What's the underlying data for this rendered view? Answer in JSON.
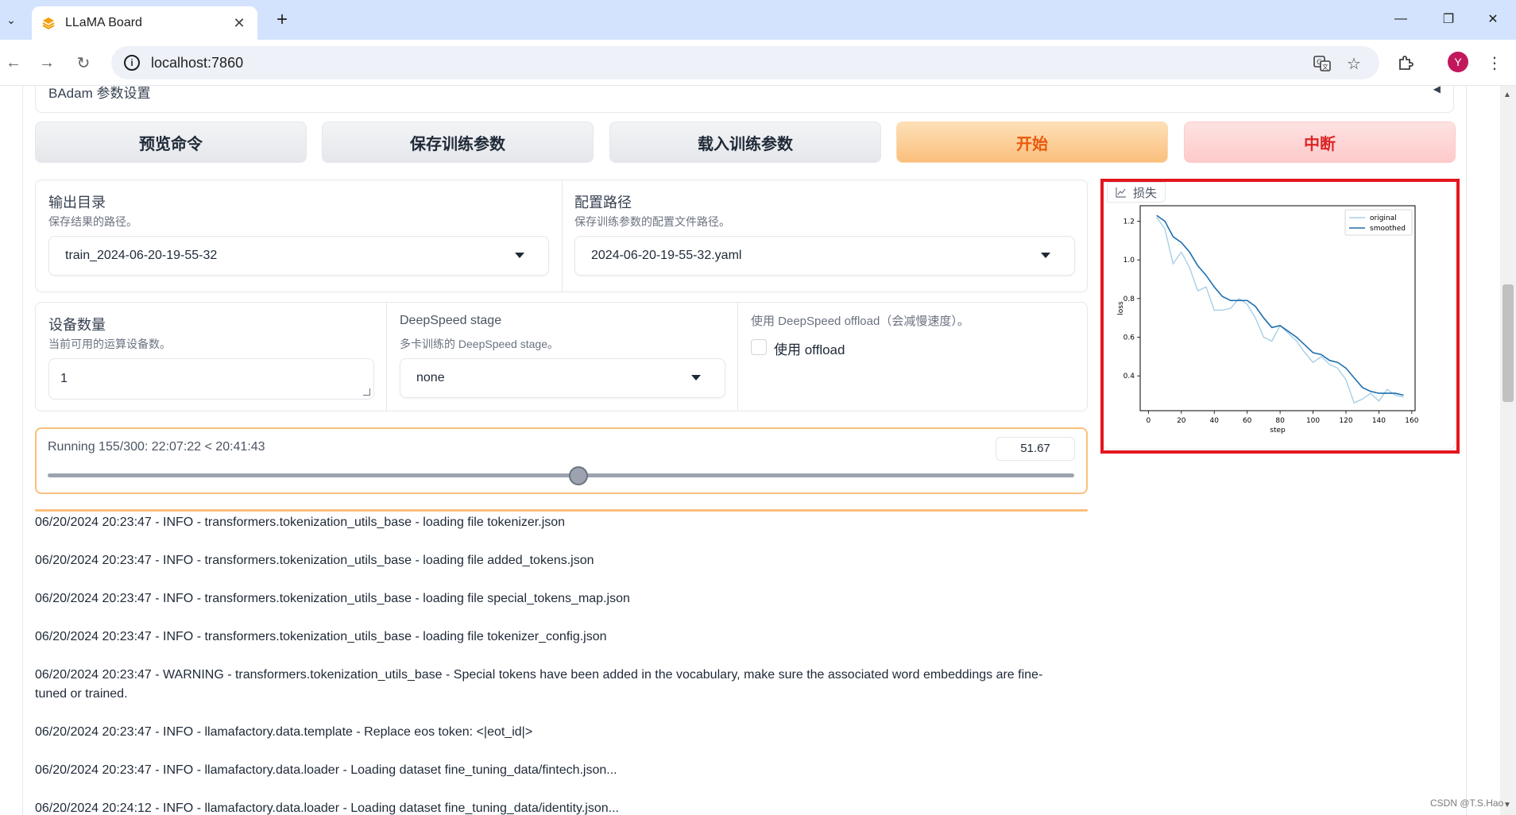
{
  "browser": {
    "tab_title": "LLaMA Board",
    "url": "localhost:7860",
    "avatar_letter": "Y"
  },
  "accordion": {
    "label": "BAdam 参数设置"
  },
  "buttons": {
    "preview": "预览命令",
    "save": "保存训练参数",
    "load": "载入训练参数",
    "start": "开始",
    "abort": "中断"
  },
  "output_dir": {
    "label": "输出目录",
    "info": "保存结果的路径。",
    "value": "train_2024-06-20-19-55-32"
  },
  "config_path": {
    "label": "配置路径",
    "info": "保存训练参数的配置文件路径。",
    "value": "2024-06-20-19-55-32.yaml"
  },
  "device_count": {
    "label": "设备数量",
    "info": "当前可用的运算设备数。",
    "value": "1"
  },
  "ds_stage": {
    "label": "DeepSpeed stage",
    "info": "多卡训练的 DeepSpeed stage。",
    "value": "none"
  },
  "ds_offload": {
    "label": "使用 DeepSpeed offload（会减慢速度）。",
    "checkbox_label": "使用 offload"
  },
  "progress": {
    "label": "Running 155/300: 22:07:22 < 20:41:43",
    "value_text": "51.67",
    "fraction": 0.5167
  },
  "logs": [
    "06/20/2024 20:23:47 - INFO - transformers.tokenization_utils_base - loading file tokenizer.json",
    "06/20/2024 20:23:47 - INFO - transformers.tokenization_utils_base - loading file added_tokens.json",
    "06/20/2024 20:23:47 - INFO - transformers.tokenization_utils_base - loading file special_tokens_map.json",
    "06/20/2024 20:23:47 - INFO - transformers.tokenization_utils_base - loading file tokenizer_config.json",
    "06/20/2024 20:23:47 - WARNING - transformers.tokenization_utils_base - Special tokens have been added in the vocabulary, make sure the associated word embeddings are fine-tuned or trained.",
    "06/20/2024 20:23:47 - INFO - llamafactory.data.template - Replace eos token: <|eot_id|>",
    "06/20/2024 20:23:47 - INFO - llamafactory.data.loader - Loading dataset fine_tuning_data/fintech.json...",
    "06/20/2024 20:24:12 - INFO - llamafactory.data.loader - Loading dataset fine_tuning_data/identity.json..."
  ],
  "chart_panel": {
    "label": "损失"
  },
  "chart_data": {
    "type": "line",
    "xlabel": "step",
    "ylabel": "loss",
    "xlim": [
      -5,
      162
    ],
    "ylim": [
      0.22,
      1.28
    ],
    "xticks": [
      0,
      20,
      40,
      60,
      80,
      100,
      120,
      140,
      160
    ],
    "yticks": [
      0.4,
      0.6,
      0.8,
      1.0,
      1.2
    ],
    "legend": "top-right",
    "series": [
      {
        "name": "original",
        "color": "#a6cfe6",
        "x": [
          5,
          10,
          15,
          20,
          25,
          30,
          35,
          40,
          45,
          50,
          55,
          60,
          65,
          70,
          75,
          80,
          85,
          90,
          95,
          100,
          105,
          110,
          115,
          120,
          125,
          130,
          135,
          140,
          145,
          150,
          155
        ],
        "y": [
          1.22,
          1.16,
          0.98,
          1.04,
          0.96,
          0.84,
          0.86,
          0.74,
          0.74,
          0.75,
          0.8,
          0.77,
          0.7,
          0.6,
          0.58,
          0.66,
          0.62,
          0.58,
          0.52,
          0.47,
          0.5,
          0.46,
          0.44,
          0.38,
          0.26,
          0.28,
          0.31,
          0.27,
          0.33,
          0.3,
          0.29
        ]
      },
      {
        "name": "smoothed",
        "color": "#1f6fae",
        "x": [
          5,
          10,
          15,
          20,
          25,
          30,
          35,
          40,
          45,
          50,
          55,
          60,
          65,
          70,
          75,
          80,
          85,
          90,
          95,
          100,
          105,
          110,
          115,
          120,
          125,
          130,
          135,
          140,
          145,
          150,
          155
        ],
        "y": [
          1.23,
          1.2,
          1.12,
          1.09,
          1.04,
          0.97,
          0.92,
          0.86,
          0.81,
          0.79,
          0.79,
          0.79,
          0.76,
          0.7,
          0.65,
          0.66,
          0.63,
          0.6,
          0.56,
          0.52,
          0.51,
          0.48,
          0.47,
          0.44,
          0.39,
          0.34,
          0.32,
          0.31,
          0.31,
          0.31,
          0.3
        ]
      }
    ]
  },
  "watermark": "CSDN @T.S.Hao"
}
